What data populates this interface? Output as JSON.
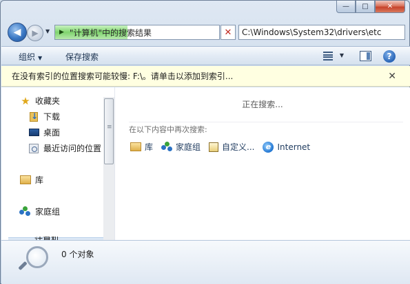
{
  "window": {
    "minimize_glyph": "—",
    "maximize_glyph": "□",
    "close_glyph": "✕"
  },
  "nav": {
    "back_glyph": "◀",
    "forward_glyph": "▶",
    "dropdown_glyph": "▼",
    "search_progress": 0.44,
    "address_text": "\"计算机\"中的搜索结果",
    "stop_glyph": "✕",
    "path_text": "C:\\Windows\\System32\\drivers\\etc"
  },
  "toolbar": {
    "organize_label": "组织",
    "organize_caret": "▼",
    "save_search_label": "保存搜索",
    "views_drop_glyph": "▼",
    "help_glyph": "?"
  },
  "info_bar": {
    "message": "在没有索引的位置搜索可能较慢: F:\\。请单击以添加到索引...",
    "close_glyph": "✕"
  },
  "sidebar": {
    "favorites_label": "收藏夹",
    "favorites_items": [
      {
        "label": "下载",
        "icon": "download-folder-icon"
      },
      {
        "label": "桌面",
        "icon": "desktop-icon"
      },
      {
        "label": "最近访问的位置",
        "icon": "recent-places-icon"
      }
    ],
    "libraries_label": "库",
    "homegroup_label": "家庭组",
    "computer_label": "计算机"
  },
  "main": {
    "searching_text": "正在搜索...",
    "search_again_label": "在以下内容中再次搜索:",
    "search_again_items": [
      {
        "label": "库",
        "icon": "library-icon"
      },
      {
        "label": "家庭组",
        "icon": "homegroup-icon"
      },
      {
        "label": "自定义...",
        "icon": "custom-icon"
      },
      {
        "label": "Internet",
        "icon": "internet-explorer-icon"
      }
    ]
  },
  "details": {
    "item_count": "0 个对象"
  },
  "colors": {
    "info_bar_bg": "#ffffe1",
    "progress_green": "#7fd46e",
    "stop_red": "#c0281e"
  }
}
